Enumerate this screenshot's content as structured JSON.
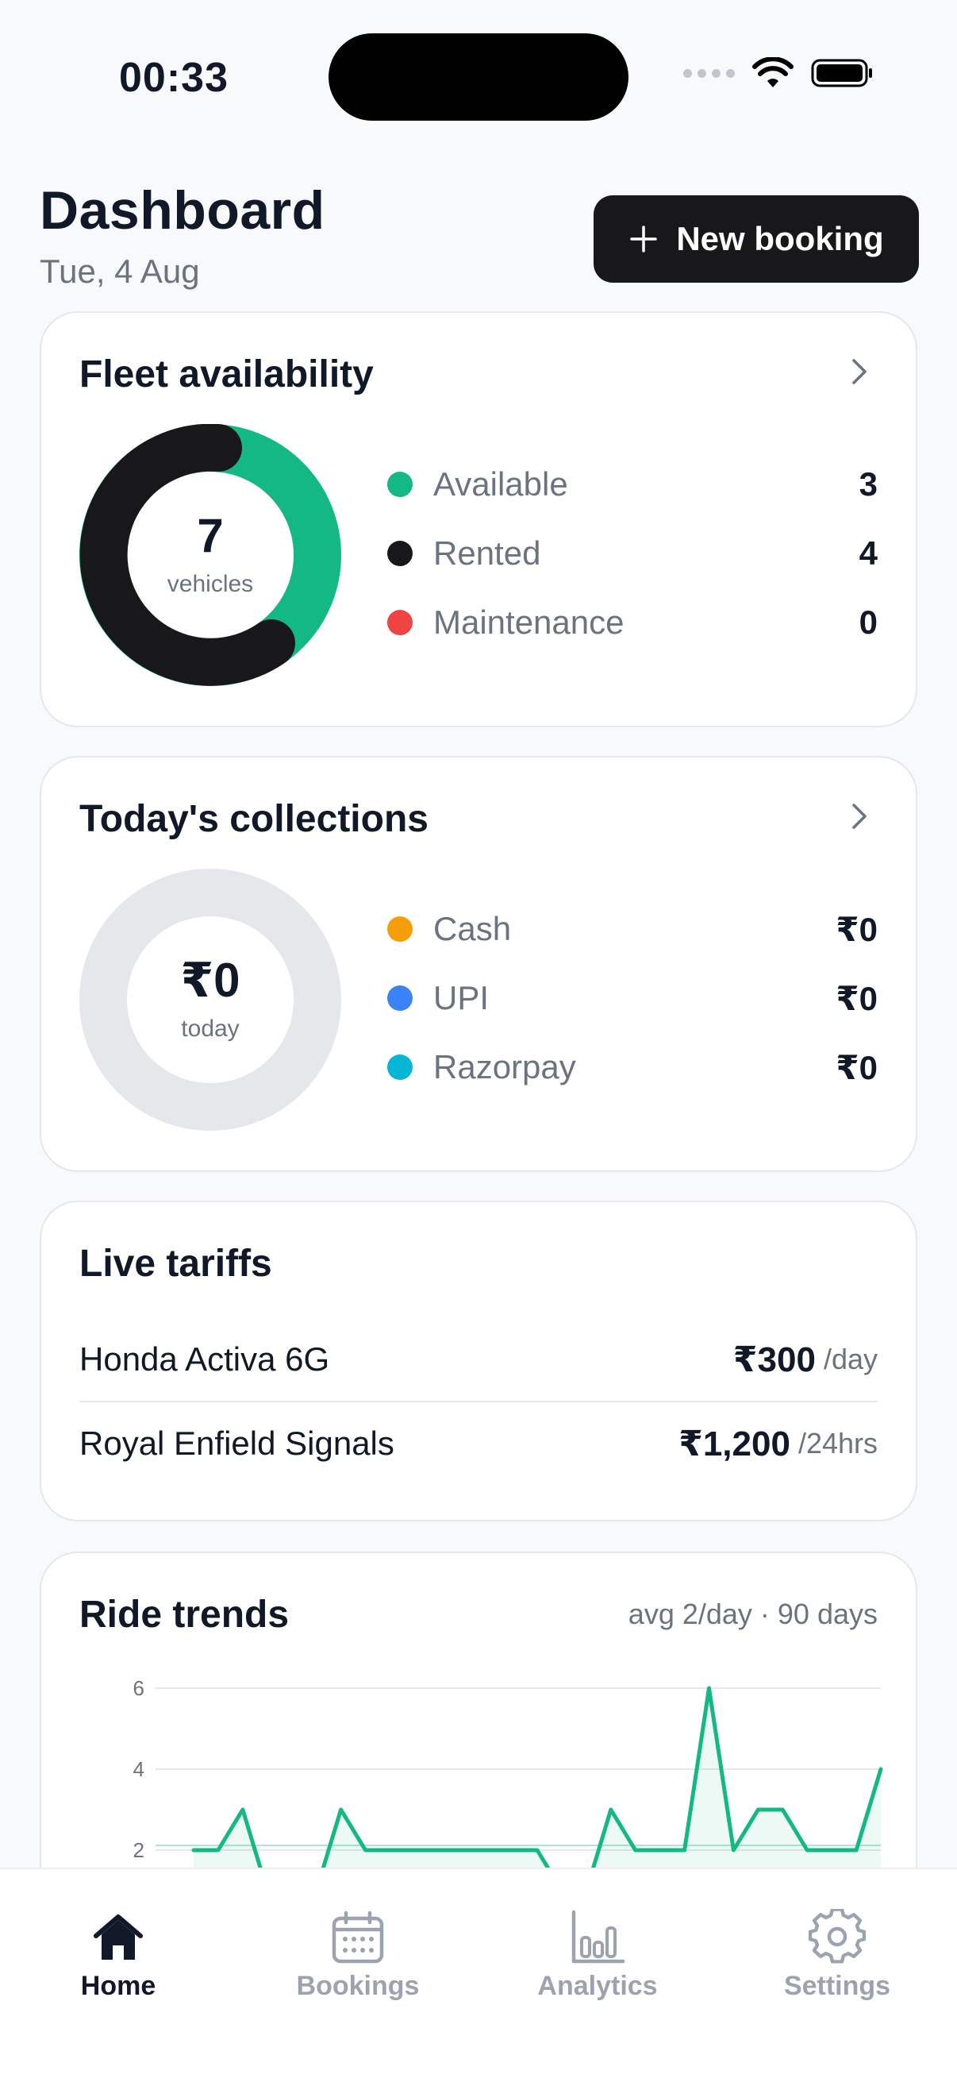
{
  "status_bar": {
    "time": "00:33"
  },
  "header": {
    "title": "Dashboard",
    "date": "Tue, 4 Aug",
    "new_booking_label": "New booking"
  },
  "fleet": {
    "title": "Fleet availability",
    "total": "7",
    "total_caption": "vehicles",
    "items": [
      {
        "label": "Available",
        "value": "3",
        "color": "#14b882"
      },
      {
        "label": "Rented",
        "value": "4",
        "color": "#18181b"
      },
      {
        "label": "Maintenance",
        "value": "0",
        "color": "#ef4444"
      }
    ]
  },
  "collections": {
    "title": "Today's collections",
    "total": "₹0",
    "total_caption": "today",
    "items": [
      {
        "label": "Cash",
        "value": "₹0",
        "color": "#f59e0b"
      },
      {
        "label": "UPI",
        "value": "₹0",
        "color": "#3b82f6"
      },
      {
        "label": "Razorpay",
        "value": "₹0",
        "color": "#06b6d4"
      }
    ]
  },
  "tariffs": {
    "title": "Live tariffs",
    "rows": [
      {
        "name": "Honda Activa 6G",
        "price": "₹300",
        "unit": "/day"
      },
      {
        "name": "Royal Enfield Signals",
        "price": "₹1,200",
        "unit": "/24hrs"
      }
    ]
  },
  "trends": {
    "title": "Ride trends",
    "meta": "avg 2/day · 90 days"
  },
  "chart_data": {
    "type": "area",
    "title": "Ride trends",
    "y_ticks": [
      "6",
      "4",
      "2"
    ],
    "ylim": [
      0,
      6
    ],
    "reference_line": 2,
    "color": "#14b882",
    "grid": true,
    "series": [
      {
        "values": [
          2,
          2,
          3,
          1,
          1,
          1,
          3,
          2,
          2,
          2,
          2,
          2,
          2,
          2,
          2,
          1,
          1,
          3,
          2,
          2,
          2,
          6,
          2,
          3,
          3,
          2,
          2,
          2,
          4
        ]
      }
    ]
  },
  "tabs": [
    {
      "label": "Home",
      "icon": "home-icon",
      "active": true
    },
    {
      "label": "Bookings",
      "icon": "calendar-icon",
      "active": false
    },
    {
      "label": "Analytics",
      "icon": "bar-chart-icon",
      "active": false
    },
    {
      "label": "Settings",
      "icon": "gear-icon",
      "active": false
    }
  ],
  "colors": {
    "accent": "#14b882",
    "dark": "#18181b",
    "muted": "#9ca3af",
    "ring_empty": "#e5e7eb"
  }
}
